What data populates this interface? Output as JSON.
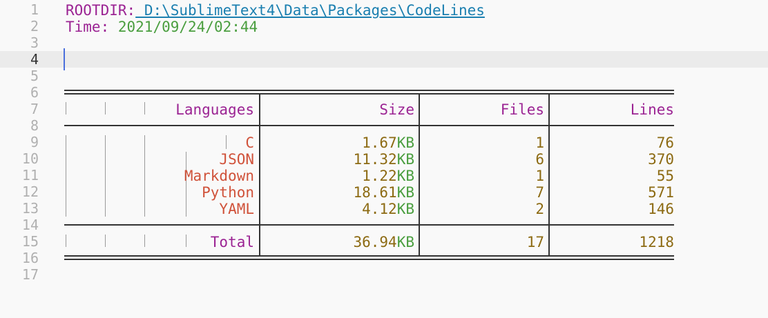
{
  "editor": {
    "active_line": 4,
    "line_numbers": [
      "1",
      "2",
      "3",
      "4",
      "5",
      "6",
      "7",
      "8",
      "9",
      "10",
      "11",
      "12",
      "13",
      "14",
      "15",
      "16",
      "17"
    ],
    "rootdir_key": "ROOTDIR",
    "rootdir_colon": ":",
    "rootdir_value": " D:\\SublimeText4\\Data\\Packages\\CodeLines",
    "time_key": "Time",
    "time_colon": ":",
    "time_value": " 2021/09/24/02:44"
  },
  "table": {
    "headers": {
      "languages": "Languages",
      "size": "Size",
      "files": "Files",
      "lines": "Lines"
    },
    "rows": [
      {
        "language": "C",
        "size_num": "1.67",
        "size_unit": "KB",
        "files": "1",
        "lines": "76"
      },
      {
        "language": "JSON",
        "size_num": "11.32",
        "size_unit": "KB",
        "files": "6",
        "lines": "370"
      },
      {
        "language": "Markdown",
        "size_num": "1.22",
        "size_unit": "KB",
        "files": "1",
        "lines": "55"
      },
      {
        "language": "Python",
        "size_num": "18.61",
        "size_unit": "KB",
        "files": "7",
        "lines": "571"
      },
      {
        "language": "YAML",
        "size_num": "4.12",
        "size_unit": "KB",
        "files": "2",
        "lines": "146"
      }
    ],
    "total": {
      "label": "Total",
      "size_num": "36.94",
      "size_unit": "KB",
      "files": "17",
      "lines": "1218"
    }
  },
  "colors": {
    "background": "#f9f9f9",
    "keyword": "#9b2393",
    "path": "#1a7fb0",
    "time": "#4a9e3f",
    "language": "#d0523a",
    "number": "#8c6a12",
    "cursor": "#4a6fdc"
  }
}
